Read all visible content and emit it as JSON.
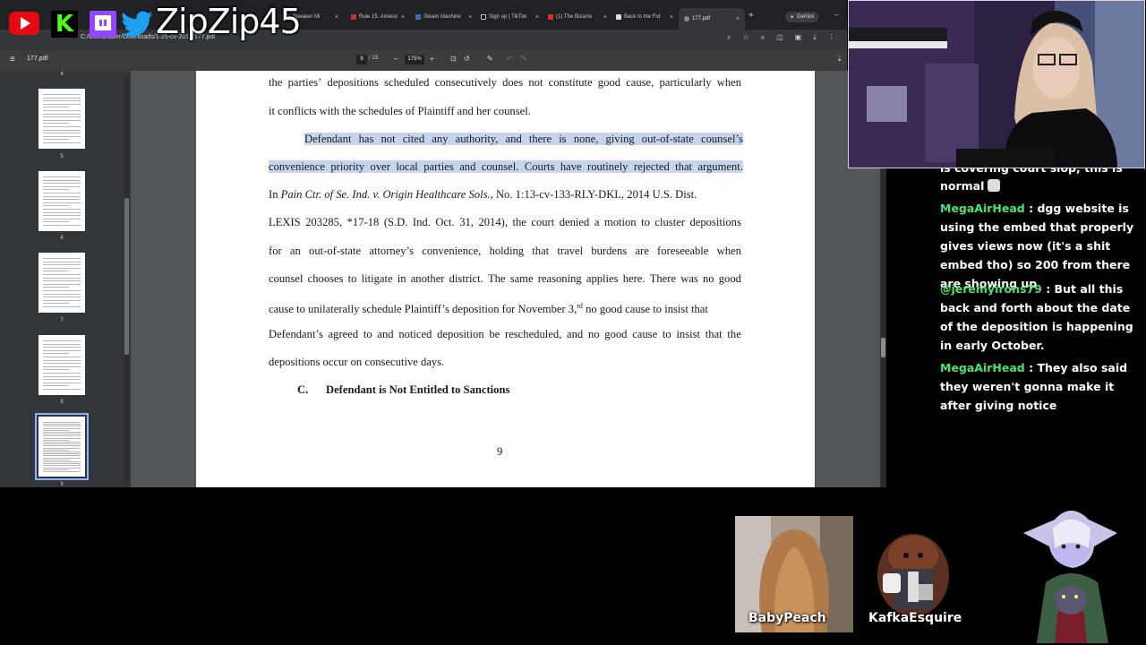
{
  "overlay": {
    "handle": "ZipZip45",
    "youtube_icon": "youtube-icon",
    "kick_icon": "kick-icon",
    "kick_letter": "K",
    "twitch_icon": "twitch-icon",
    "twitter_icon": "twitter-icon"
  },
  "browser": {
    "tabs": [
      {
        "label": "Speaker Mi"
      },
      {
        "label": "Rule 15. Amend"
      },
      {
        "label": "Steam Machine"
      },
      {
        "label": "Sign up | TikTok"
      },
      {
        "label": "(1) The Bizarre"
      },
      {
        "label": "Back to the Fut"
      },
      {
        "label": "177.pdf"
      }
    ],
    "gemini_label": "Gemini",
    "address": "C:/Users/tober/Downloads/1-25-cv-2017/177.pdf"
  },
  "pdf": {
    "file_name": "177.pdf",
    "page_current": "9",
    "page_total": "/ 13",
    "zoom": "175%",
    "thumbnails": [
      {
        "num": "4"
      },
      {
        "num": "5"
      },
      {
        "num": "6"
      },
      {
        "num": "7"
      },
      {
        "num": "8"
      },
      {
        "num": "9"
      }
    ],
    "body": {
      "l1": [
        "the",
        "parties’",
        "depositions",
        "scheduled",
        "consecutively",
        "does",
        "not",
        "constitute",
        "good",
        "cause,",
        "particularly",
        "when"
      ],
      "l2": "it conflicts with the schedules of Plaintiff and her counsel.",
      "l3": [
        "Defendant",
        "has",
        "not",
        "cited",
        "any",
        "authority,",
        "and",
        "there",
        "is",
        "none,",
        "giving",
        "out-of-state",
        "counsel’s"
      ],
      "l4": [
        "convenience",
        "priority",
        "over",
        "local",
        "parties",
        "and",
        "counsel.",
        "Courts",
        "have",
        "routinely",
        "rejected",
        "that",
        "argument."
      ],
      "l5_pre": "In ",
      "l5_case": "Pain Ctr. of Se. Ind. v. Origin Healthcare Sols.",
      "l5_post": ", No. 1:13-cv-133-RLY-DKL, 2014 U.S. Dist.",
      "l6": [
        "LEXIS",
        "203285,",
        "*17-18",
        "(S.D.",
        "Ind.",
        "Oct.",
        "31,",
        "2014),",
        "the",
        "court",
        "denied",
        "a",
        "motion",
        "to",
        "cluster",
        "depositions"
      ],
      "l7": [
        "for",
        "an",
        "out-of-state",
        "attorney’s",
        "convenience,",
        "holding",
        "that",
        "travel",
        "burdens",
        "are",
        "foreseeable",
        "when"
      ],
      "l8": [
        "counsel",
        "chooses",
        "to",
        "litigate",
        "in",
        "another",
        "district.",
        "The",
        "same",
        "reasoning",
        "applies",
        "here.",
        "There",
        "was",
        "no",
        "good"
      ],
      "l9_pre": "cause to unilaterally schedule Plaintiff’s deposition for November 3,",
      "l9_sup": "rd",
      "l9_post": " no good cause to insist that",
      "l10": [
        "Defendant’s",
        "agreed",
        "to",
        "and",
        "noticed",
        "deposition",
        "be",
        "rescheduled,",
        "and",
        "no",
        "good",
        "cause",
        "to",
        "insist",
        "that",
        "the"
      ],
      "l11": "depositions occur on consecutive days.",
      "heading_label": "C.",
      "heading_text": "Defendant is Not Entitled to Sanctions",
      "page_number": "9"
    }
  },
  "chat": {
    "partial_top": "is covering court slop, this is",
    "partial_second": "normal",
    "messages": [
      {
        "user": "MegaAirHead",
        "text": " : dgg website is using the embed that properly gives views now (it's a shit embed tho) so 200 from there are showing up"
      },
      {
        "user": "@jeremyirons79",
        "text": " : But all this back and forth about the date of the deposition is happening in early October."
      },
      {
        "user": "MegaAirHead",
        "text": " : They also said they weren't gonna make it after giving notice"
      }
    ]
  },
  "avatars": {
    "baby_peach": "BabyPeach",
    "kafka": "KafkaEsquire"
  }
}
